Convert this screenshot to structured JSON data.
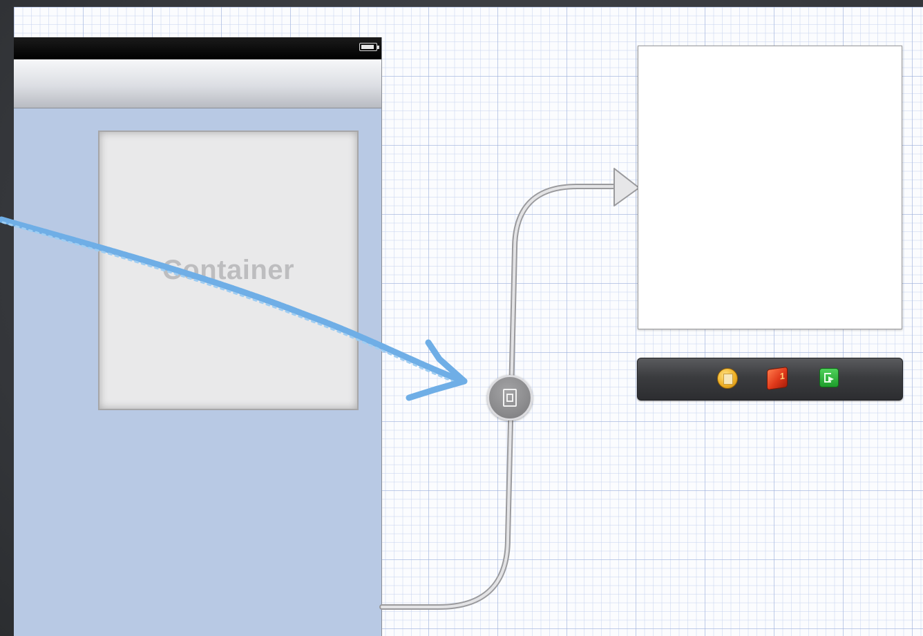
{
  "storyboard": {
    "container_view": {
      "label": "Container"
    },
    "icons": {
      "status_bar": "battery-icon",
      "segue": "embed-segue-icon",
      "dock": [
        "view-controller-icon",
        "first-responder-icon",
        "exit-icon"
      ]
    }
  },
  "colors": {
    "canvas": "#fbfcfe",
    "grid_line": "#96aad7",
    "view_background": "#b8c9e4",
    "annotation_arrow": "#6faee6",
    "dark_backdrop": "#3a3c40"
  }
}
